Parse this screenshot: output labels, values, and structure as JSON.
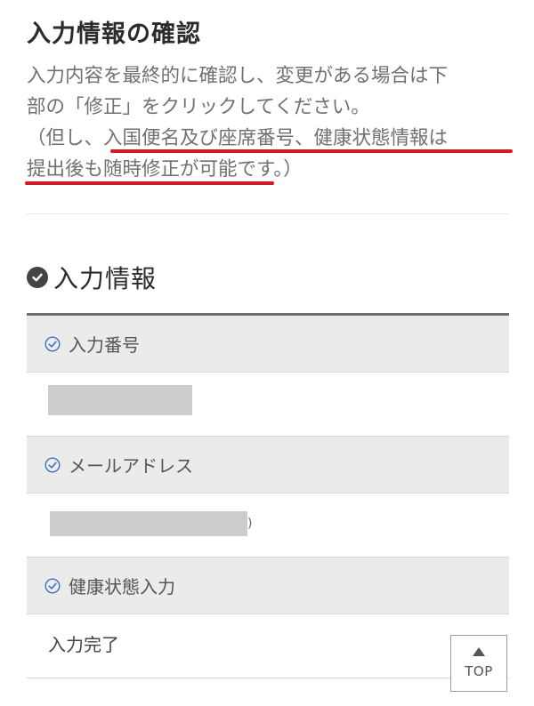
{
  "page": {
    "title": "入力情報の確認",
    "intro": {
      "line1": "入力内容を最終的に確認し、変更がある場合は下",
      "line2": "部の「修正」をクリックしてください。",
      "line3": "（但し、入国便名及び座席番号、健康状態情報は",
      "line4": "提出後も随時修正が可能です。）"
    }
  },
  "section": {
    "heading": "入力情報"
  },
  "fields": [
    {
      "label": "入力番号",
      "value": ""
    },
    {
      "label": "メールアドレス",
      "value": "",
      "trailing_char": ")"
    },
    {
      "label": "健康状態入力",
      "value": "入力完了"
    }
  ],
  "top_button": {
    "label": "TOP"
  },
  "colors": {
    "underline": "#d01a26",
    "header_bg": "#ebebeb",
    "redaction": "#cccccc"
  },
  "icons": {
    "section": "check-circle-filled-icon",
    "field": "check-circle-outline-icon",
    "top": "arrow-up-icon"
  }
}
